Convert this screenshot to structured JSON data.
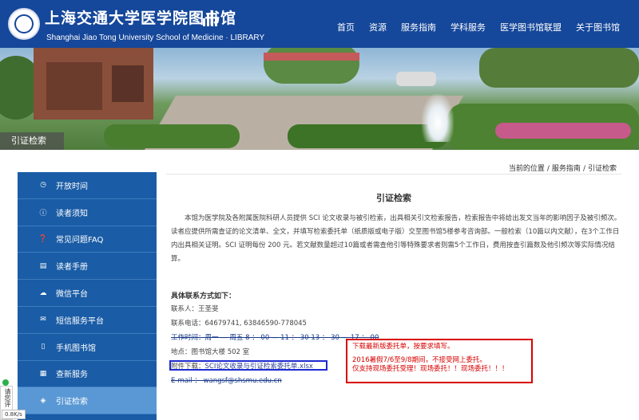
{
  "header": {
    "title_cn": "上海交通大学医学院图书馆",
    "title_en": "Shanghai Jiao Tong University School of Medicine · LIBRARY",
    "nav": [
      "首页",
      "资源",
      "服务指南",
      "学科服务",
      "医学图书馆联盟",
      "关于图书馆"
    ]
  },
  "banner": {
    "tag": "引证检索"
  },
  "breadcrumb": [
    "当前的位置",
    "服务指南",
    "引证检索"
  ],
  "sidebar": {
    "items": [
      {
        "label": "开放时间",
        "icon": "clock-icon"
      },
      {
        "label": "读者须知",
        "icon": "info-icon"
      },
      {
        "label": "常见问题FAQ",
        "icon": "question-icon"
      },
      {
        "label": "读者手册",
        "icon": "book-icon"
      },
      {
        "label": "微信平台",
        "icon": "wechat-icon"
      },
      {
        "label": "短信服务平台",
        "icon": "message-icon"
      },
      {
        "label": "手机图书馆",
        "icon": "phone-icon"
      },
      {
        "label": "查新服务",
        "icon": "search-doc-icon"
      },
      {
        "label": "引证检索",
        "icon": "shield-icon"
      }
    ],
    "active_index": 8
  },
  "main": {
    "title": "引证检索",
    "paragraph": "本馆为医学院及各附属医院科研人员提供 SCI 论文收录与被引检索，出具相关引文检索报告，检索报告中将给出发文当年的影响因子及被引频次。读者应提供所需查证的论文清单、全文，并填写检索委托单（纸质版或电子版）交至图书馆5楼参考咨询部。一般检索（10篇以内文献），在3个工作日内出具相关证明。SCI 证明每份 200 元。若文献数量超过10篇或者需查他引等特殊要求者则需5个工作日，费用按查引篇数及他引频次等实际情况结算。",
    "contact_heading": "具体联系方式如下：",
    "contact_person": "联系人：王圣斐",
    "phone": "联系电话：64679741, 63846590-778045",
    "hours": "工作时间：周一 — 周五 8 ： 00 — 11 ： 30 13 ： 30 — 17 ： 00",
    "address": "地点：图书馆大楼 502 室",
    "attachment_prefix": "附件下载：",
    "attachment_link": "SCI论文收录与引证检索委托单.xlsx",
    "email": "E-mail ： wangsf@shsmu.edu.cn"
  },
  "notice": {
    "line1": "下载最新版委托单，按要求填写。",
    "line2": "2016暑假7/6至9/8期间，不接受网上委托。",
    "line3": "仅支持现场委托受理！现场委托！！现场委托！！！"
  },
  "widgets": {
    "feedback_label": "请您评",
    "speed": "0.8K/s"
  }
}
